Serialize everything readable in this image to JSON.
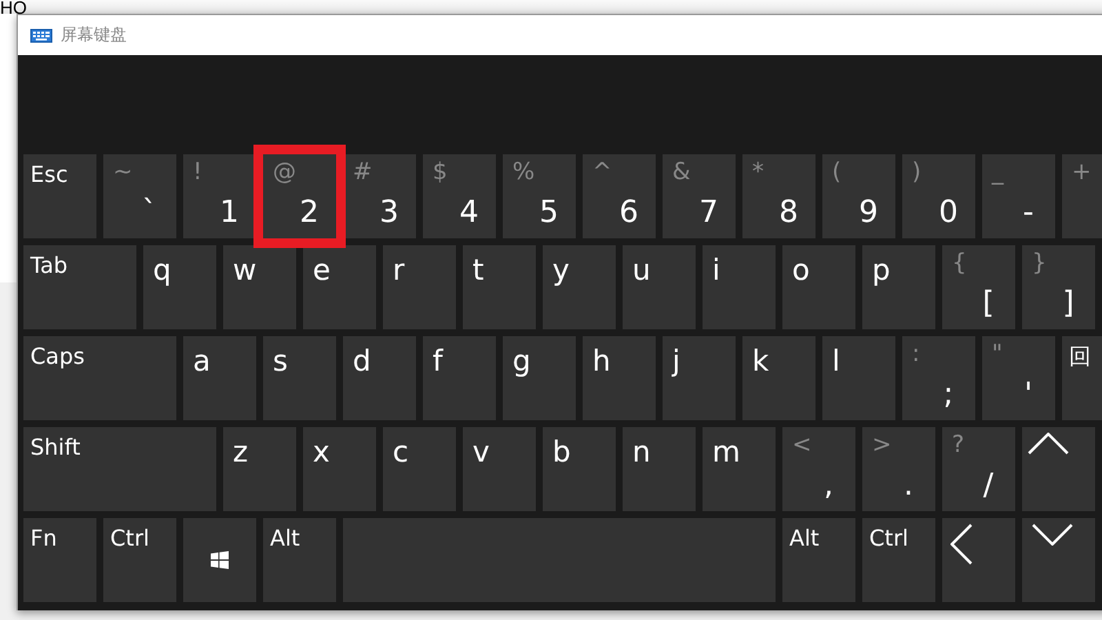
{
  "background_text": "HO",
  "window": {
    "title": "屏幕键盘"
  },
  "keyboard": {
    "rows": [
      {
        "keys": [
          {
            "kind": "function",
            "label": "Esc",
            "highlighted": false
          },
          {
            "kind": "symbol",
            "shift": "~",
            "label": "`",
            "highlighted": false
          },
          {
            "kind": "symbol",
            "shift": "!",
            "label": "1",
            "highlighted": false
          },
          {
            "kind": "symbol",
            "shift": "@",
            "label": "2",
            "highlighted": true
          },
          {
            "kind": "symbol",
            "shift": "#",
            "label": "3",
            "highlighted": false
          },
          {
            "kind": "symbol",
            "shift": "$",
            "label": "4",
            "highlighted": false
          },
          {
            "kind": "symbol",
            "shift": "%",
            "label": "5",
            "highlighted": false
          },
          {
            "kind": "symbol",
            "shift": "^",
            "label": "6",
            "highlighted": false
          },
          {
            "kind": "symbol",
            "shift": "&",
            "label": "7",
            "highlighted": false
          },
          {
            "kind": "symbol",
            "shift": "*",
            "label": "8",
            "highlighted": false
          },
          {
            "kind": "symbol",
            "shift": "(",
            "label": "9",
            "highlighted": false
          },
          {
            "kind": "symbol",
            "shift": ")",
            "label": "0",
            "highlighted": false
          },
          {
            "kind": "symbol",
            "shift": "_",
            "label": "-",
            "highlighted": false
          },
          {
            "kind": "symbol",
            "shift": "+",
            "highlighted": false
          }
        ]
      },
      {
        "keys": [
          {
            "kind": "function",
            "label": "Tab",
            "highlighted": false
          },
          {
            "kind": "letter",
            "label": "q",
            "highlighted": false
          },
          {
            "kind": "letter",
            "label": "w",
            "highlighted": false
          },
          {
            "kind": "letter",
            "label": "e",
            "highlighted": false
          },
          {
            "kind": "letter",
            "label": "r",
            "highlighted": false
          },
          {
            "kind": "letter",
            "label": "t",
            "highlighted": false
          },
          {
            "kind": "letter",
            "label": "y",
            "highlighted": false
          },
          {
            "kind": "letter",
            "label": "u",
            "highlighted": false
          },
          {
            "kind": "letter",
            "label": "i",
            "highlighted": false
          },
          {
            "kind": "letter",
            "label": "o",
            "highlighted": false
          },
          {
            "kind": "letter",
            "label": "p",
            "highlighted": false
          },
          {
            "kind": "symbol",
            "shift": "{",
            "label": "[",
            "highlighted": false
          },
          {
            "kind": "symbol",
            "shift": "}",
            "label": "]",
            "highlighted": false
          }
        ]
      },
      {
        "keys": [
          {
            "kind": "function",
            "label": "Caps",
            "highlighted": false
          },
          {
            "kind": "letter",
            "label": "a",
            "highlighted": false
          },
          {
            "kind": "letter",
            "label": "s",
            "highlighted": false
          },
          {
            "kind": "letter",
            "label": "d",
            "highlighted": false
          },
          {
            "kind": "letter",
            "label": "f",
            "highlighted": false
          },
          {
            "kind": "letter",
            "label": "g",
            "highlighted": false
          },
          {
            "kind": "letter",
            "label": "h",
            "highlighted": false
          },
          {
            "kind": "letter",
            "label": "j",
            "highlighted": false
          },
          {
            "kind": "letter",
            "label": "k",
            "highlighted": false
          },
          {
            "kind": "letter",
            "label": "l",
            "highlighted": false
          },
          {
            "kind": "symbol",
            "shift": ":",
            "label": ";",
            "highlighted": false
          },
          {
            "kind": "symbol",
            "shift": "\"",
            "label": "'",
            "highlighted": false
          },
          {
            "kind": "function",
            "label": "回",
            "highlighted": false
          }
        ]
      },
      {
        "keys": [
          {
            "kind": "function",
            "label": "Shift",
            "highlighted": false
          },
          {
            "kind": "letter",
            "label": "z",
            "highlighted": false
          },
          {
            "kind": "letter",
            "label": "x",
            "highlighted": false
          },
          {
            "kind": "letter",
            "label": "c",
            "highlighted": false
          },
          {
            "kind": "letter",
            "label": "v",
            "highlighted": false
          },
          {
            "kind": "letter",
            "label": "b",
            "highlighted": false
          },
          {
            "kind": "letter",
            "label": "n",
            "highlighted": false
          },
          {
            "kind": "letter",
            "label": "m",
            "highlighted": false
          },
          {
            "kind": "symbol",
            "shift": "<",
            "label": ",",
            "highlighted": false
          },
          {
            "kind": "symbol",
            "shift": ">",
            "label": ".",
            "highlighted": false
          },
          {
            "kind": "symbol",
            "shift": "?",
            "label": "/",
            "highlighted": false
          },
          {
            "kind": "up",
            "highlighted": false
          }
        ]
      },
      {
        "keys": [
          {
            "kind": "function",
            "label": "Fn",
            "highlighted": false
          },
          {
            "kind": "function",
            "label": "Ctrl",
            "highlighted": false
          },
          {
            "kind": "windows",
            "highlighted": false
          },
          {
            "kind": "function",
            "label": "Alt",
            "highlighted": false
          },
          {
            "kind": "space",
            "highlighted": false
          },
          {
            "kind": "function",
            "label": "Alt",
            "highlighted": false
          },
          {
            "kind": "function",
            "label": "Ctrl",
            "highlighted": false
          },
          {
            "kind": "left",
            "highlighted": false
          },
          {
            "kind": "down",
            "highlighted": false
          }
        ]
      }
    ]
  }
}
